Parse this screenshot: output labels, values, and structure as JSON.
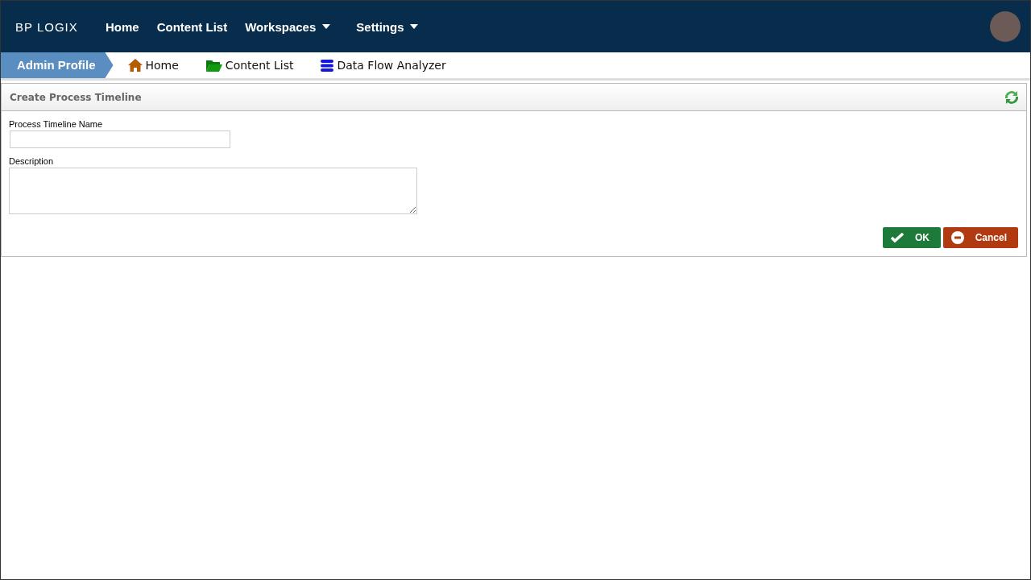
{
  "logo": {
    "text": "BP LOGIX"
  },
  "nav": [
    {
      "label": "Home",
      "dropdown": false
    },
    {
      "label": "Content List",
      "dropdown": false
    },
    {
      "label": "Workspaces",
      "dropdown": true
    },
    {
      "label": "Settings",
      "dropdown": true
    }
  ],
  "breadcrumb": {
    "current": "Admin Profile",
    "links": [
      {
        "label": "Home",
        "kind": "home"
      },
      {
        "label": "Content List",
        "kind": "folder"
      },
      {
        "label": "Data Flow Analyzer",
        "kind": "database"
      }
    ]
  },
  "panel": {
    "title": "Create Process Timeline",
    "fields": [
      {
        "label": "Process Timeline Name",
        "kind": "text"
      },
      {
        "label": "Description",
        "kind": "textarea"
      }
    ],
    "buttons": [
      {
        "label": "OK",
        "kind": "ok"
      },
      {
        "label": "Cancel",
        "kind": "cancel"
      }
    ]
  }
}
